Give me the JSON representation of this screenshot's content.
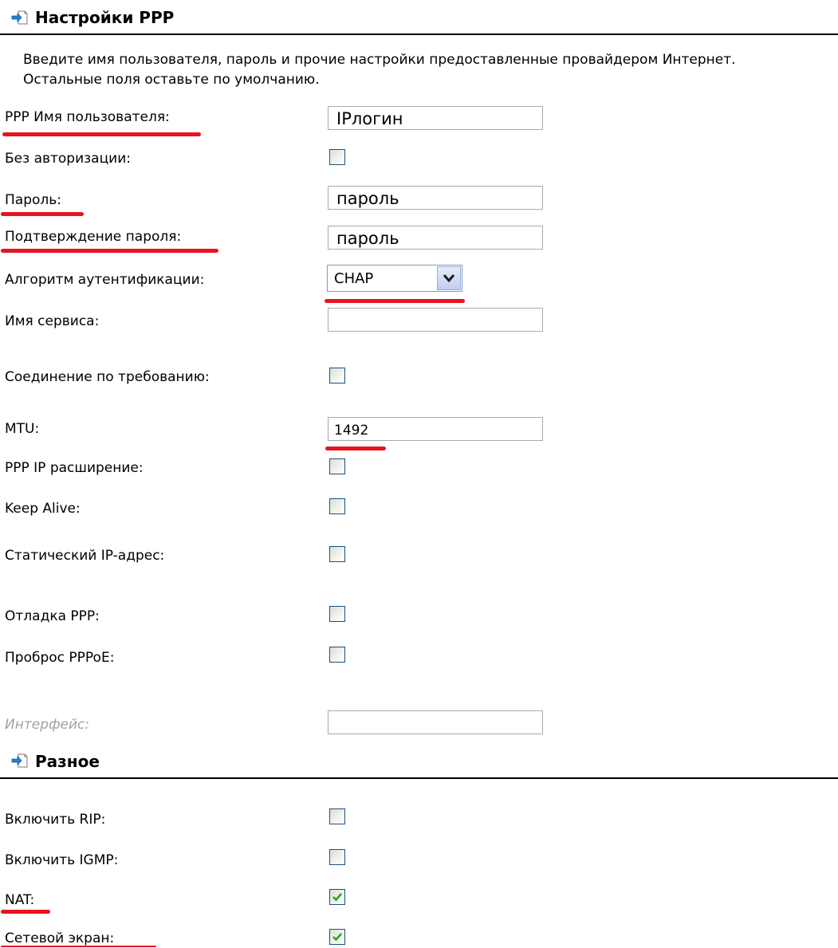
{
  "ppp": {
    "title": "Настройки PPP",
    "intro_line1": "Введите имя пользователя, пароль и прочие настройки предоставленные провайдером Интернет.",
    "intro_line2": "Остальные поля оставьте по умолчанию.",
    "username_label": "PPP Имя пользователя:",
    "username_value": "IPлогин",
    "no_auth_label": "Без авторизации:",
    "password_label": "Пароль:",
    "password_value": "пароль",
    "confirm_label": "Подтверждение пароля:",
    "confirm_value": "пароль",
    "auth_algo_label": "Алгоритм аутентификации:",
    "auth_algo_value": "CHAP",
    "service_name_label": "Имя сервиса:",
    "service_name_value": "",
    "on_demand_label": "Соединение по требованию:",
    "mtu_label": "MTU:",
    "mtu_value": "1492",
    "ip_ext_label": "PPP IP расширение:",
    "keep_alive_label": "Keep Alive:",
    "static_ip_label": "Статический IP-адрес:",
    "debug_label": "Отладка PPP:",
    "passthrough_label": "Проброс PPPoE:",
    "interface_label": "Интерфейс:",
    "interface_value": ""
  },
  "misc": {
    "title": "Разное",
    "rip_label": "Включить RIP:",
    "igmp_label": "Включить IGMP:",
    "nat_label": "NAT:",
    "firewall_label": "Сетевой экран:"
  },
  "checkbox_states": {
    "no_auth": false,
    "on_demand": false,
    "ip_ext": false,
    "keep_alive": false,
    "static_ip": false,
    "debug": false,
    "passthrough": false,
    "rip": false,
    "igmp": false,
    "nat": true,
    "firewall": true
  },
  "icons": {
    "section_icon": "arrow-into-page-icon",
    "dropdown_icon": "chevron-down-icon",
    "check_icon": "checkmark-icon"
  },
  "colors": {
    "highlight_underline": "#e8141e",
    "checkmark": "#22a622",
    "section_icon_arrow": "#1e7fd6"
  }
}
